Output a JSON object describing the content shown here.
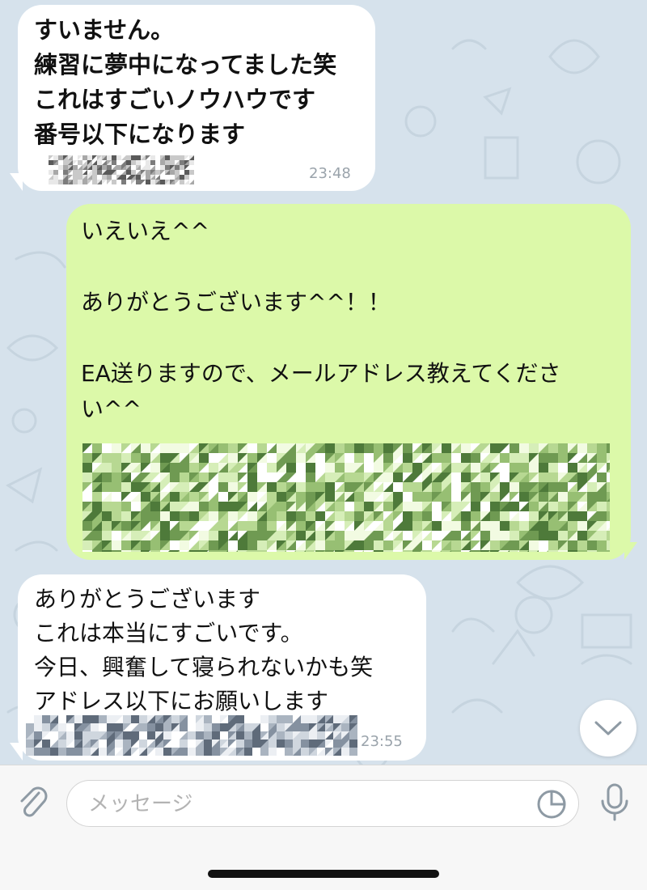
{
  "messages": [
    {
      "direction": "incoming",
      "text": "すいません。\n練習に夢中になってました笑\nこれはすごいノウハウです\n番号以下になります",
      "time": "23:48"
    },
    {
      "direction": "outgoing",
      "text": "いえいえ^^\n\nありがとうございます^^！！\n\nEA送りますので、メールアドレス教えてくださ\nい^^"
    },
    {
      "direction": "incoming",
      "text": "ありがとうございます\nこれは本当にすごいです。\n今日、興奮して寝られないかも笑\nアドレス以下にお願いします",
      "time": "23:55"
    }
  ],
  "composer": {
    "placeholder": "メッセージ"
  },
  "icons": {
    "attach": "paperclip-icon",
    "sticker": "sticker-icon",
    "mic": "microphone-icon",
    "scroll_down": "chevron-down-icon"
  },
  "colors": {
    "chat_background": "#d6e2ec",
    "incoming_bubble": "#ffffff",
    "outgoing_bubble": "#dcf9a9",
    "time_text": "#9aa3ab"
  }
}
